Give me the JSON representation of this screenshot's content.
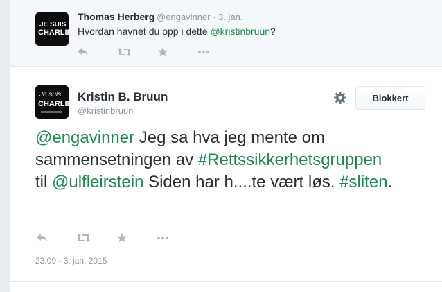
{
  "parent_tweet": {
    "author_name": "Thomas Herberg",
    "author_handle": "@engavinner",
    "time": "· 3. jan.",
    "text_prefix": "Hvordan havnet du opp i dette ",
    "text_mention": "@kristinbruun",
    "text_suffix": "?",
    "avatar_line1": "JE SUIS",
    "avatar_line2": "CHARLIE"
  },
  "main_tweet": {
    "author_name": "Kristin B. Bruun",
    "author_handle": "@kristinbruun",
    "avatar_line1": "Je suis",
    "avatar_line2": "CHARLIE",
    "block_button": "Blokkert",
    "parts": {
      "m1": "@engavinner",
      "t1": " Jeg sa hva jeg mente om sammensetningen av ",
      "m2": "#Rettssikkerhetsgruppen",
      "t2": " til ",
      "m3": "@ulfleirstein",
      "t3": " Siden har h....te vært løs. ",
      "m4": "#sliten",
      "t4": "."
    },
    "timestamp": "23.09 - 3. jan. 2015"
  },
  "action_icons": [
    "reply-icon",
    "retweet-icon",
    "favorite-icon",
    "more-icon"
  ],
  "colors": {
    "link": "#1c8a4e",
    "icon": "#aab8c2",
    "text": "#292f33",
    "muted": "#8899a6"
  }
}
